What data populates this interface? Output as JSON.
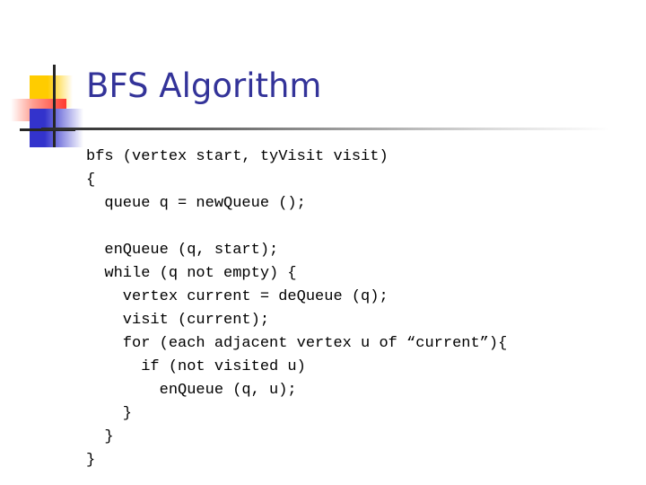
{
  "slide": {
    "title": "BFS Algorithm",
    "title_color": "#333399",
    "background_color": "#ffffff"
  },
  "decoration": {
    "name": "slide-logo-decoration",
    "yellow_color": "#FFCC00",
    "red_color": "#FF3B30",
    "blue_color": "#3333CC",
    "line_color": "#262626"
  },
  "rule": {
    "start_color": "#2b2b2b",
    "end_color": "#ffffff"
  },
  "code": {
    "language": "pseudocode",
    "lines": [
      "bfs (vertex start, tyVisit visit)",
      "{",
      "  queue q = newQueue ();",
      "",
      "  enQueue (q, start);",
      "  while (q not empty) {",
      "    vertex current = deQueue (q);",
      "    visit (current);",
      "    for (each adjacent vertex u of “current”){",
      "      if (not visited u)",
      "        enQueue (q, u);",
      "    }",
      "  }",
      "}"
    ]
  }
}
